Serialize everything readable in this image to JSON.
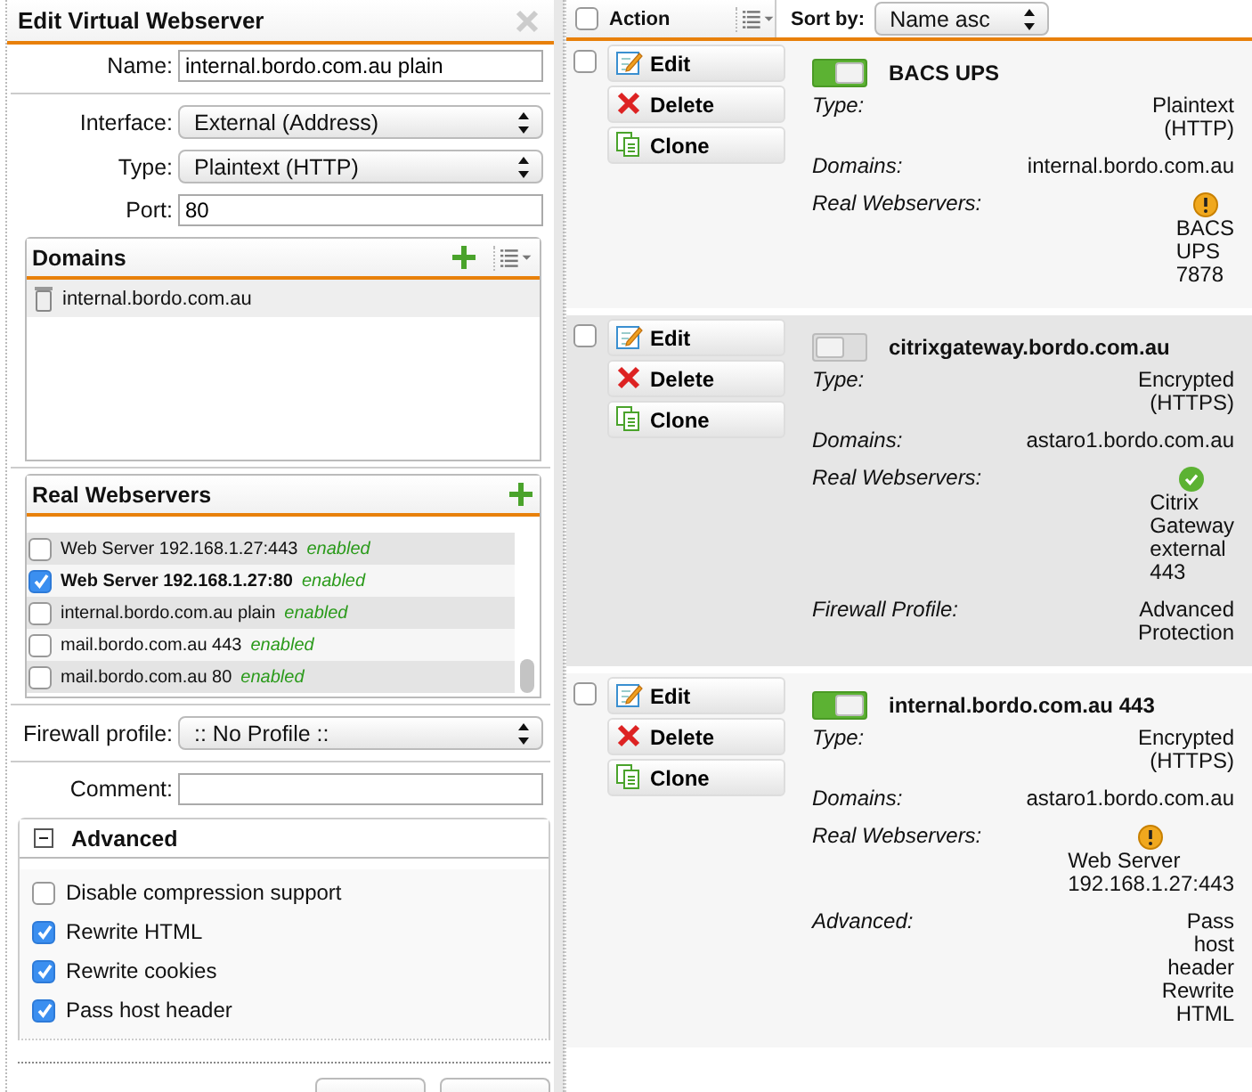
{
  "dialog": {
    "title": "Edit Virtual Webserver",
    "fields": [
      {
        "kind": "text",
        "label": "Name:",
        "value": "internal.bordo.com.au plain"
      },
      {
        "kind": "select",
        "label": "Interface:",
        "value": "External (Address)"
      },
      {
        "kind": "select",
        "label": "Type:",
        "value": "Plaintext (HTTP)"
      },
      {
        "kind": "text",
        "label": "Port:",
        "value": "80"
      }
    ],
    "domains": {
      "title": "Domains",
      "items": [
        "internal.bordo.com.au"
      ]
    },
    "real_webservers": {
      "title": "Real Webservers",
      "items": [
        {
          "name": "Web Server 192.168.1.27:443",
          "status": "enabled",
          "checked": false
        },
        {
          "name": "Web Server 192.168.1.27:80",
          "status": "enabled",
          "checked": true
        },
        {
          "name": "internal.bordo.com.au plain",
          "status": "enabled",
          "checked": false
        },
        {
          "name": "mail.bordo.com.au 443",
          "status": "enabled",
          "checked": false
        },
        {
          "name": "mail.bordo.com.au 80",
          "status": "enabled",
          "checked": false
        }
      ]
    },
    "firewall_profile": {
      "label": "Firewall profile:",
      "value": ":: No Profile ::"
    },
    "comment": {
      "label": "Comment:"
    },
    "advanced": {
      "title": "Advanced",
      "expanded": true,
      "options": [
        {
          "label": "Disable compression support",
          "checked": false
        },
        {
          "label": "Rewrite HTML",
          "checked": true
        },
        {
          "label": "Rewrite cookies",
          "checked": true
        },
        {
          "label": "Pass host header",
          "checked": true
        }
      ]
    }
  },
  "list": {
    "header": {
      "select_all_checked": false,
      "action_label": "Action",
      "sort_label": "Sort by:",
      "sort_value": "Name asc"
    },
    "entries": [
      {
        "checked": false,
        "actions": [
          {
            "kind": "edit",
            "label": "Edit"
          },
          {
            "kind": "delete",
            "label": "Delete"
          },
          {
            "kind": "clone",
            "label": "Clone"
          }
        ],
        "enabled": true,
        "name": "BACS UPS",
        "details": [
          {
            "kind": "text",
            "label": "Type:",
            "value": "Plaintext (HTTP)"
          },
          {
            "kind": "text",
            "label": "Domains:",
            "value": "internal.bordo.com.au"
          },
          {
            "kind": "server",
            "label": "Real Webservers:",
            "healthy": false,
            "value": "BACS UPS 7878"
          }
        ]
      },
      {
        "checked": false,
        "actions": [
          {
            "kind": "edit",
            "label": "Edit"
          },
          {
            "kind": "delete",
            "label": "Delete"
          },
          {
            "kind": "clone",
            "label": "Clone"
          }
        ],
        "enabled": false,
        "name": "citrixgateway.bordo.com.au",
        "details": [
          {
            "kind": "text",
            "label": "Type:",
            "value": "Encrypted (HTTPS)"
          },
          {
            "kind": "text",
            "label": "Domains:",
            "value": "astaro1.bordo.com.au"
          },
          {
            "kind": "server",
            "label": "Real Webservers:",
            "healthy": true,
            "value": "Citrix Gateway external 443"
          },
          {
            "kind": "text",
            "label": "Firewall Profile:",
            "value": "Advanced Protection"
          }
        ]
      },
      {
        "checked": false,
        "actions": [
          {
            "kind": "edit",
            "label": "Edit"
          },
          {
            "kind": "delete",
            "label": "Delete"
          },
          {
            "kind": "clone",
            "label": "Clone"
          }
        ],
        "enabled": true,
        "name": "internal.bordo.com.au 443",
        "details": [
          {
            "kind": "text",
            "label": "Type:",
            "value": "Encrypted (HTTPS)"
          },
          {
            "kind": "text",
            "label": "Domains:",
            "value": "astaro1.bordo.com.au"
          },
          {
            "kind": "server",
            "label": "Real Webservers:",
            "healthy": false,
            "value": "Web Server 192.168.1.27:443"
          },
          {
            "kind": "text",
            "label": "Advanced:",
            "value": "Pass host header Rewrite HTML"
          }
        ]
      }
    ]
  }
}
